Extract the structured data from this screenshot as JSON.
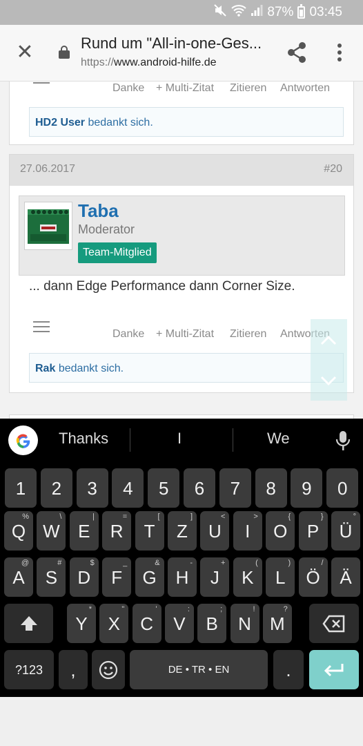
{
  "status_bar": {
    "battery": "87%",
    "time": "03:45"
  },
  "browser": {
    "title": "Rund um \"All-in-one-Ges...",
    "url_scheme": "https://",
    "url_domain": "www.android-hilfe.de",
    "icons": {
      "close": "close-icon",
      "lock": "lock-icon",
      "share": "share-icon",
      "menu": "more-vert-icon"
    }
  },
  "prev_post": {
    "actions": [
      "Danke",
      "+ Multi-Zitat",
      "Zitieren",
      "Antworten"
    ],
    "likes_user": "HD2 User",
    "likes_suffix": "bedankt sich."
  },
  "post": {
    "date": "27.06.2017",
    "number": "#20",
    "username": "Taba",
    "role": "Moderator",
    "badge": "Team-Mitglied",
    "text": "... dann Edge Performance dann Corner Size.",
    "actions": [
      "Danke",
      "+ Multi-Zitat",
      "Zitieren",
      "Antworten"
    ],
    "likes_user": "Rak",
    "likes_suffix": "bedankt sich."
  },
  "keyboard": {
    "suggestions": [
      "Thanks",
      "I",
      "We"
    ],
    "row_numbers": [
      "1",
      "2",
      "3",
      "4",
      "5",
      "6",
      "7",
      "8",
      "9",
      "0"
    ],
    "row1": [
      [
        "Q",
        "%"
      ],
      [
        "W",
        "\\"
      ],
      [
        "E",
        "|"
      ],
      [
        "R",
        "="
      ],
      [
        "T",
        "["
      ],
      [
        "Z",
        "]"
      ],
      [
        "U",
        "<"
      ],
      [
        "I",
        ">"
      ],
      [
        "O",
        "{"
      ],
      [
        "P",
        "}"
      ],
      [
        "Ü",
        "°"
      ]
    ],
    "row2": [
      [
        "A",
        "@"
      ],
      [
        "S",
        "#"
      ],
      [
        "D",
        "$"
      ],
      [
        "F",
        "_"
      ],
      [
        "G",
        "&"
      ],
      [
        "H",
        "-"
      ],
      [
        "J",
        "+"
      ],
      [
        "K",
        "("
      ],
      [
        "L",
        ")"
      ],
      [
        "Ö",
        "/"
      ],
      [
        "Ä",
        ""
      ]
    ],
    "row3": [
      [
        "Y",
        "*"
      ],
      [
        "X",
        "\""
      ],
      [
        "C",
        "'"
      ],
      [
        "V",
        ":"
      ],
      [
        "B",
        ";"
      ],
      [
        "N",
        "!"
      ],
      [
        "M",
        "?"
      ]
    ],
    "symbols_key": "?123",
    "comma_key": ",",
    "space_label": "DE • TR • EN",
    "period_key": "."
  }
}
